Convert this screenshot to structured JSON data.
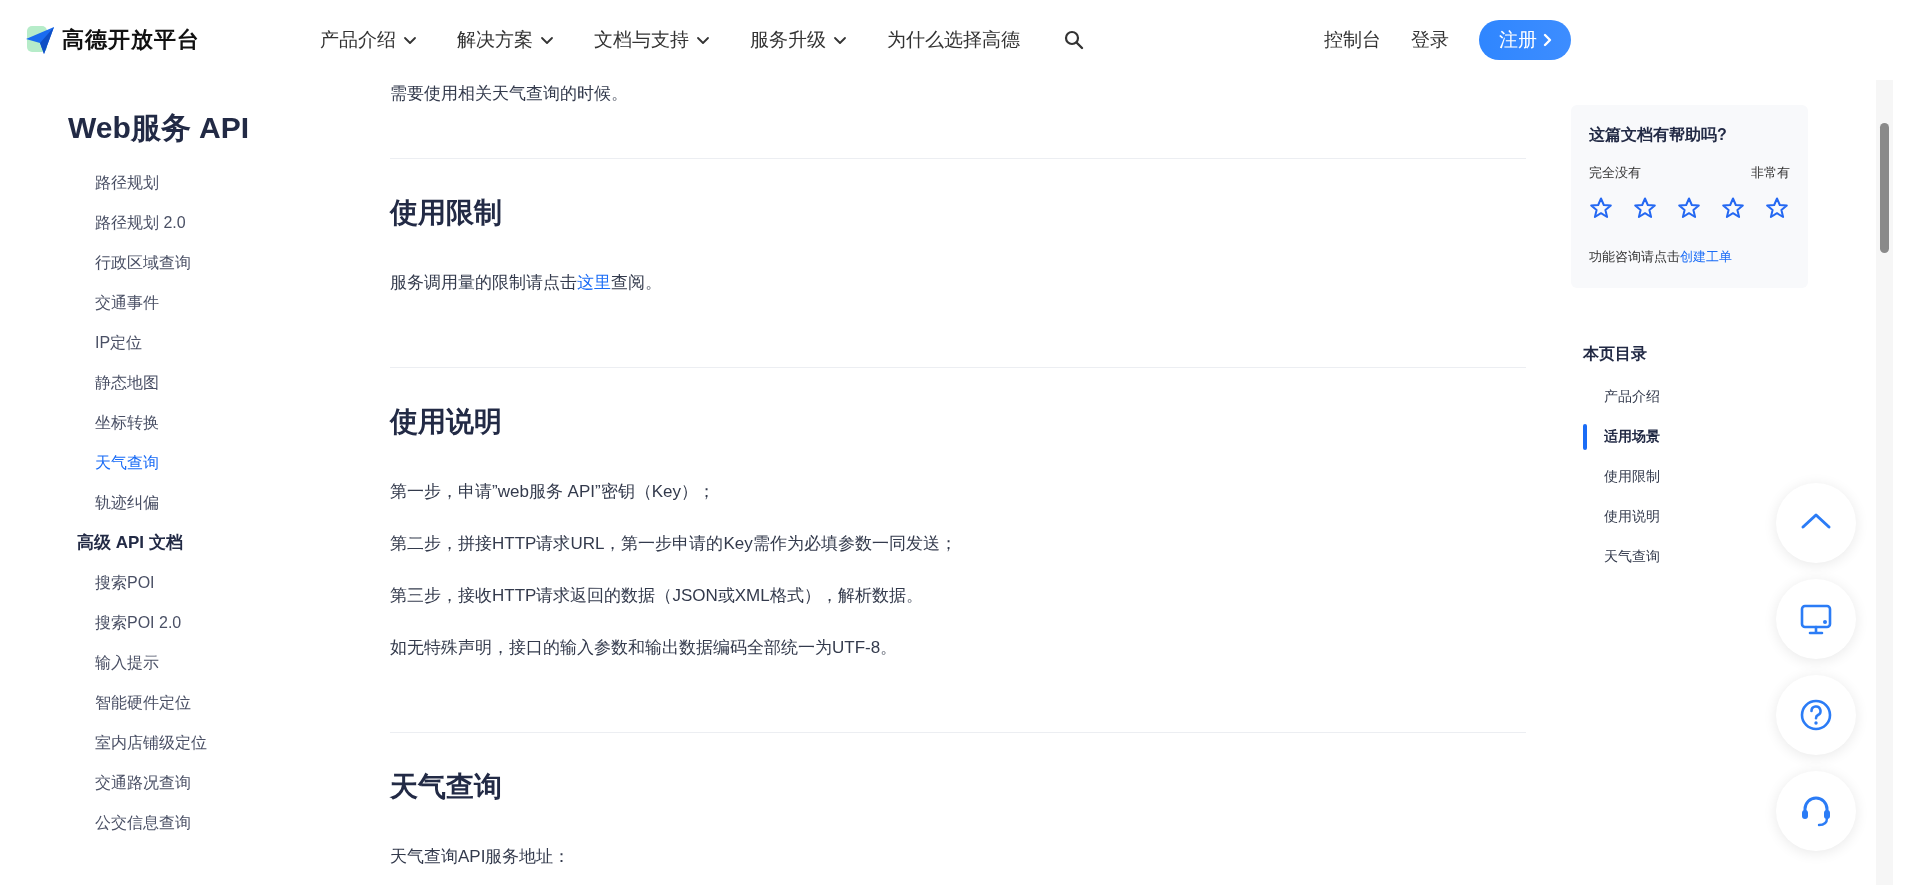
{
  "header": {
    "logo_text": "高德开放平台",
    "nav": [
      {
        "label": "产品介绍",
        "dropdown": true
      },
      {
        "label": "解决方案",
        "dropdown": true
      },
      {
        "label": "文档与支持",
        "dropdown": true
      },
      {
        "label": "服务升级",
        "dropdown": true
      },
      {
        "label": "为什么选择高德",
        "dropdown": false
      }
    ],
    "links": [
      "控制台",
      "登录"
    ],
    "register": "注册"
  },
  "sidebar": {
    "title": "Web服务 API",
    "items": [
      {
        "label": "路径规划",
        "selected": false
      },
      {
        "label": "路径规划 2.0",
        "selected": false
      },
      {
        "label": "行政区域查询",
        "selected": false
      },
      {
        "label": "交通事件",
        "selected": false
      },
      {
        "label": "IP定位",
        "selected": false
      },
      {
        "label": "静态地图",
        "selected": false
      },
      {
        "label": "坐标转换",
        "selected": false
      },
      {
        "label": "天气查询",
        "selected": true
      },
      {
        "label": "轨迹纠偏",
        "selected": false
      }
    ],
    "groups": [
      {
        "title": "高级 API 文档",
        "items": [
          {
            "label": "搜索POI",
            "selected": false
          },
          {
            "label": "搜索POI 2.0",
            "selected": false
          },
          {
            "label": "输入提示",
            "selected": false
          },
          {
            "label": "智能硬件定位",
            "selected": false
          },
          {
            "label": "室内店铺级定位",
            "selected": false
          },
          {
            "label": "交通路况查询",
            "selected": false
          },
          {
            "label": "公交信息查询",
            "selected": false
          }
        ]
      }
    ]
  },
  "content": {
    "lead": "需要使用相关天气查询的时候。",
    "sections": [
      {
        "heading": "使用限制",
        "paragraphs": [
          [
            {
              "text": "服务调用量的限制请点击",
              "link": false
            },
            {
              "text": "这里",
              "link": true
            },
            {
              "text": "查阅。",
              "link": false
            }
          ]
        ]
      },
      {
        "heading": "使用说明",
        "paragraphs": [
          [
            {
              "text": "第一步，申请”web服务 API”密钥（Key）；",
              "link": false
            }
          ],
          [
            {
              "text": "第二步，拼接HTTP请求URL，第一步申请的Key需作为必填参数一同发送；",
              "link": false
            }
          ],
          [
            {
              "text": "第三步，接收HTTP请求返回的数据（JSON或XML格式），解析数据。",
              "link": false
            }
          ],
          [
            {
              "text": "如无特殊声明，接口的输入参数和输出数据编码全部统一为UTF-8。",
              "link": false
            }
          ]
        ]
      },
      {
        "heading": "天气查询",
        "paragraphs": [
          [
            {
              "text": "天气查询API服务地址：",
              "link": false
            }
          ]
        ]
      }
    ]
  },
  "feedback": {
    "title": "这篇文档有帮助吗?",
    "low_label": "完全没有",
    "high_label": "非常有",
    "stars": 0,
    "note": "功能咨询请点击",
    "note_link": "创建工单"
  },
  "toc": {
    "title": "本页目录",
    "items": [
      {
        "label": "产品介绍",
        "selected": false
      },
      {
        "label": "适用场景",
        "selected": true
      },
      {
        "label": "使用限制",
        "selected": false
      },
      {
        "label": "使用说明",
        "selected": false
      },
      {
        "label": "天气查询",
        "selected": false
      }
    ]
  },
  "float_buttons": [
    {
      "kind": "top"
    },
    {
      "kind": "monitor"
    },
    {
      "kind": "help"
    },
    {
      "kind": "support"
    }
  ]
}
